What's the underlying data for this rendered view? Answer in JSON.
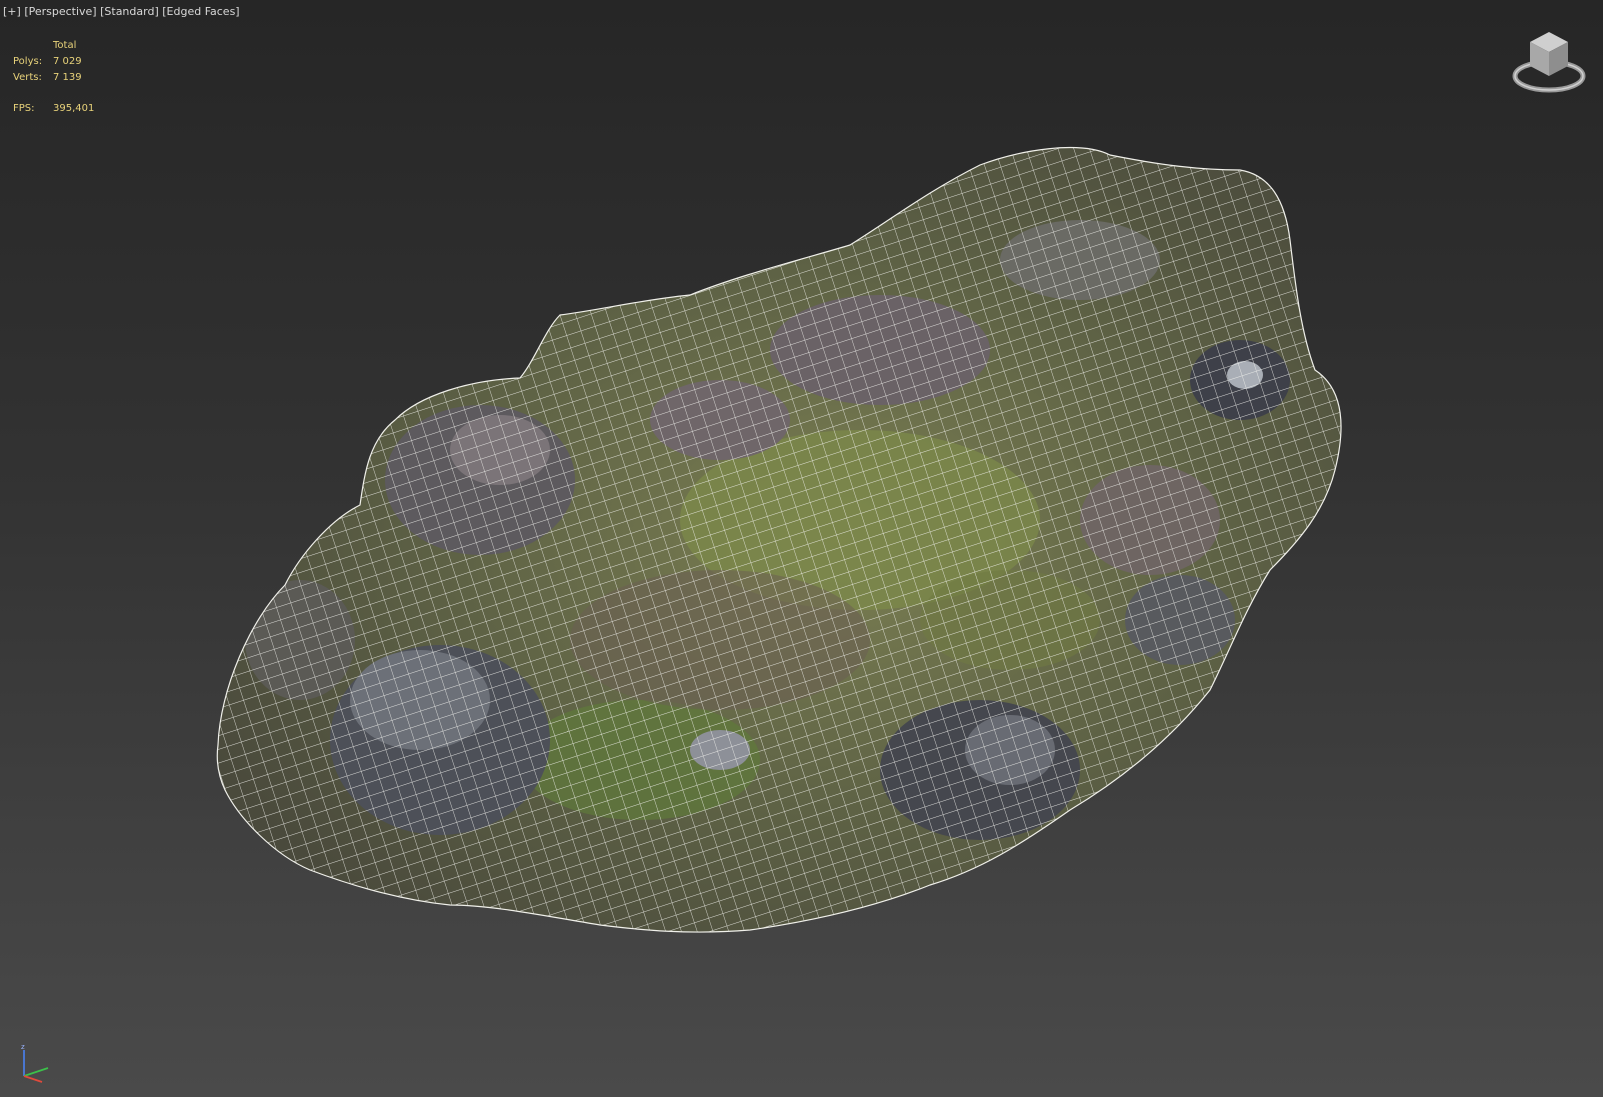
{
  "viewport": {
    "plus": "[+]",
    "view": "[Perspective]",
    "shading": "[Standard]",
    "mode": "[Edged Faces]"
  },
  "stats": {
    "header": "Total",
    "polys_label": "Polys:",
    "polys_value": "7 029",
    "verts_label": "Verts:",
    "verts_value": "7 139",
    "fps_label": "FPS:",
    "fps_value": "395,401"
  },
  "colors": {
    "stats_text": "#e8d27a",
    "wireframe": "#ffffff",
    "background_top": "#262626",
    "background_bottom": "#4a4a4a"
  },
  "icons": {
    "viewcube": "viewcube-icon",
    "axis": "axis-tripod-icon"
  }
}
